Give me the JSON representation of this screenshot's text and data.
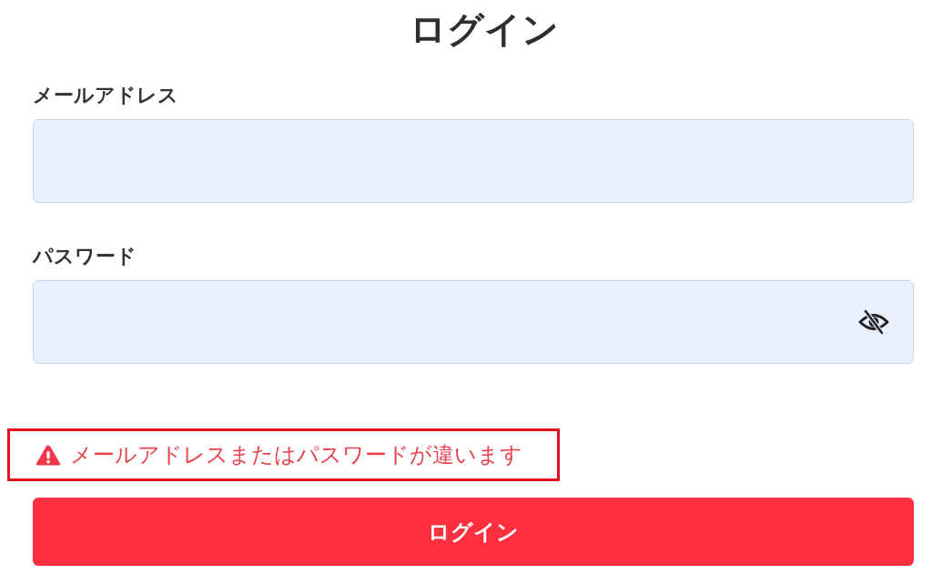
{
  "title": "ログイン",
  "fields": [
    {
      "label": "メールアドレス",
      "kind": "text"
    },
    {
      "label": "パスワード",
      "kind": "password"
    }
  ],
  "error": {
    "message": "メールアドレスまたはパスワードが違います",
    "highlighted": true
  },
  "submit_button": {
    "label": "ログイン"
  }
}
